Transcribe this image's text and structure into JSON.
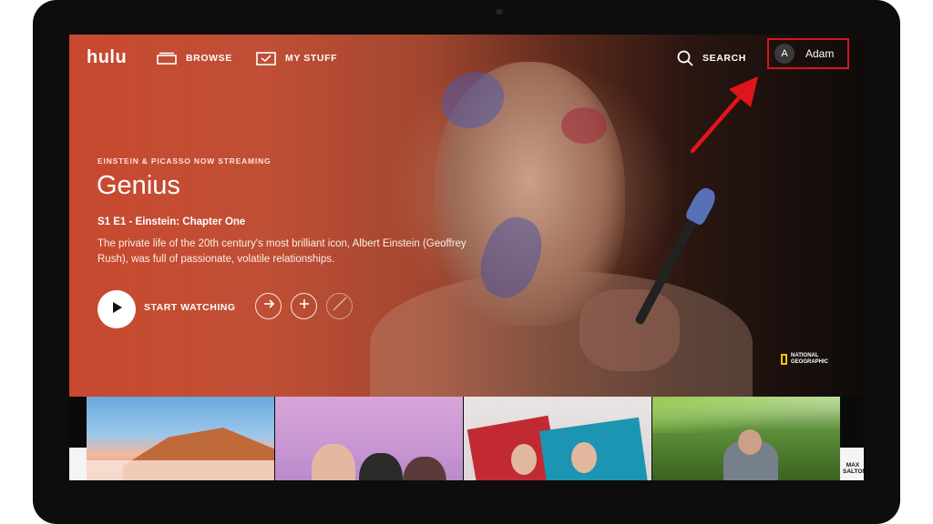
{
  "nav": {
    "logo": "hulu",
    "browse": "BROWSE",
    "my_stuff": "MY STUFF",
    "search": "SEARCH",
    "user_initial": "A",
    "user_name": "Adam"
  },
  "hero": {
    "eyebrow": "EINSTEIN & PICASSO NOW STREAMING",
    "title": "Genius",
    "episode": "S1 E1 - Einstein: Chapter One",
    "description": "The private life of the 20th century's most brilliant icon, Albert Einstein (Geoffrey Rush), was full of passionate, volatile relationships.",
    "start_label": "START WATCHING",
    "network": "NATIONAL GEOGRAPHIC"
  },
  "tiles": {
    "badge": "MAX SALTON"
  },
  "colors": {
    "highlight": "#d8151a",
    "hero_red": "#c8492f"
  }
}
